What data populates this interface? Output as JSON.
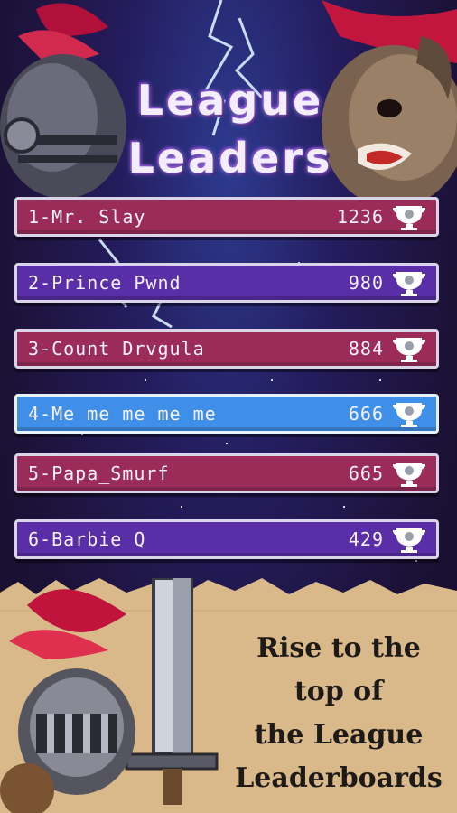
{
  "title": {
    "line1": "League",
    "line2": "Leaders"
  },
  "leaderboard": [
    {
      "rank_name": "1-Mr. Slay",
      "score": "1236",
      "style": "red"
    },
    {
      "rank_name": "2-Prince Pwnd",
      "score": "980",
      "style": "purple"
    },
    {
      "rank_name": "3-Count Drvgula",
      "score": "884",
      "style": "red"
    },
    {
      "rank_name": "4-Me me me me me",
      "score": "666",
      "style": "blue"
    },
    {
      "rank_name": "5-Papa_Smurf",
      "score": "665",
      "style": "red"
    },
    {
      "rank_name": "6-Barbie Q",
      "score": "429",
      "style": "purple"
    }
  ],
  "tagline": {
    "line1": "Rise to the",
    "line2": "top of",
    "line3": "the League",
    "line4": "Leaderboards"
  },
  "icons": {
    "score": "trophy-icon"
  },
  "colors": {
    "red_row": "#9b2c5a",
    "purple_row": "#5a2ea6",
    "highlight_row": "#3f8fe8",
    "parchment": "#d9b98a"
  }
}
